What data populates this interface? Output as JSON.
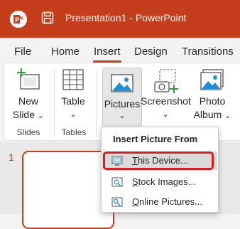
{
  "titlebar": {
    "title": "Presentation1  -  PowerPoint",
    "app_icon": "powerpoint-logo-icon",
    "save_icon": "save-icon"
  },
  "tabs": [
    {
      "label": "File"
    },
    {
      "label": "Home"
    },
    {
      "label": "Insert",
      "active": true
    },
    {
      "label": "Design"
    },
    {
      "label": "Transitions"
    }
  ],
  "ribbon": {
    "new_slide": {
      "line1": "New",
      "line2": "Slide",
      "icon": "new-slide-icon"
    },
    "table": {
      "label": "Table",
      "icon": "table-icon"
    },
    "pictures": {
      "label": "Pictures",
      "icon": "pictures-icon"
    },
    "screenshot": {
      "label": "Screenshot",
      "icon": "screenshot-icon"
    },
    "photo_album": {
      "line1": "Photo",
      "line2": "Album",
      "icon": "photo-album-icon"
    },
    "groups": {
      "slides": "Slides",
      "tables": "Tables"
    }
  },
  "workspace": {
    "slide_number": "1"
  },
  "menu": {
    "header": "Insert Picture From",
    "items": [
      {
        "underline": "T",
        "rest": "his Device...",
        "icon": "this-device-icon"
      },
      {
        "underline": "S",
        "rest": "tock Images...",
        "icon": "stock-images-icon"
      },
      {
        "underline": "O",
        "rest": "nline Pictures...",
        "icon": "online-pictures-icon"
      }
    ]
  },
  "colors": {
    "brand": "#c43e1c",
    "highlight": "#d81b1b"
  }
}
